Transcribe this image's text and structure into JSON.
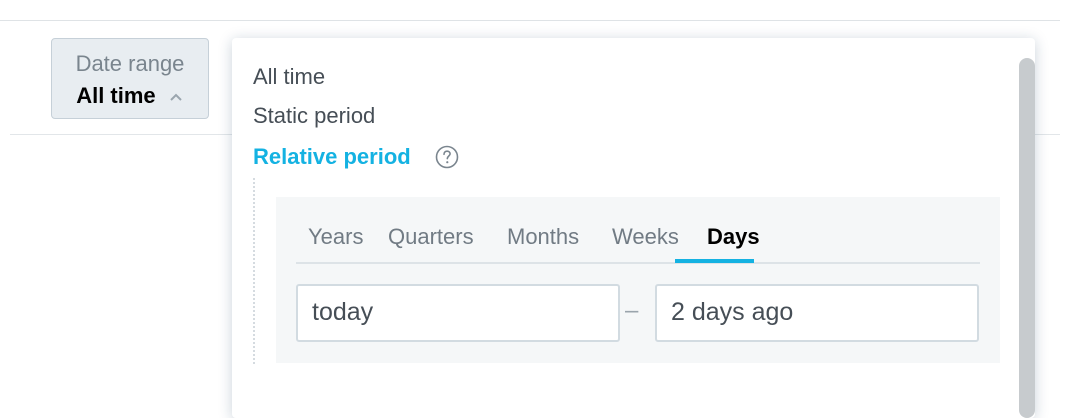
{
  "date_range_button": {
    "label": "Date range",
    "value": "All time",
    "chevron_icon": "chevron-up-icon"
  },
  "dropdown": {
    "options": [
      {
        "label": "All time"
      },
      {
        "label": "Static period"
      },
      {
        "label": "Relative period",
        "selected": true
      }
    ],
    "help_icon": "question-circle-icon",
    "relative": {
      "tabs": [
        {
          "label": "Years"
        },
        {
          "label": "Quarters"
        },
        {
          "label": "Months"
        },
        {
          "label": "Weeks"
        },
        {
          "label": "Days",
          "active": true
        }
      ],
      "from_value": "today",
      "separator": "–",
      "to_value": "2 days ago"
    }
  },
  "colors": {
    "accent": "#14b2e2",
    "button_bg": "#e8edf1",
    "text": "#464e56"
  }
}
